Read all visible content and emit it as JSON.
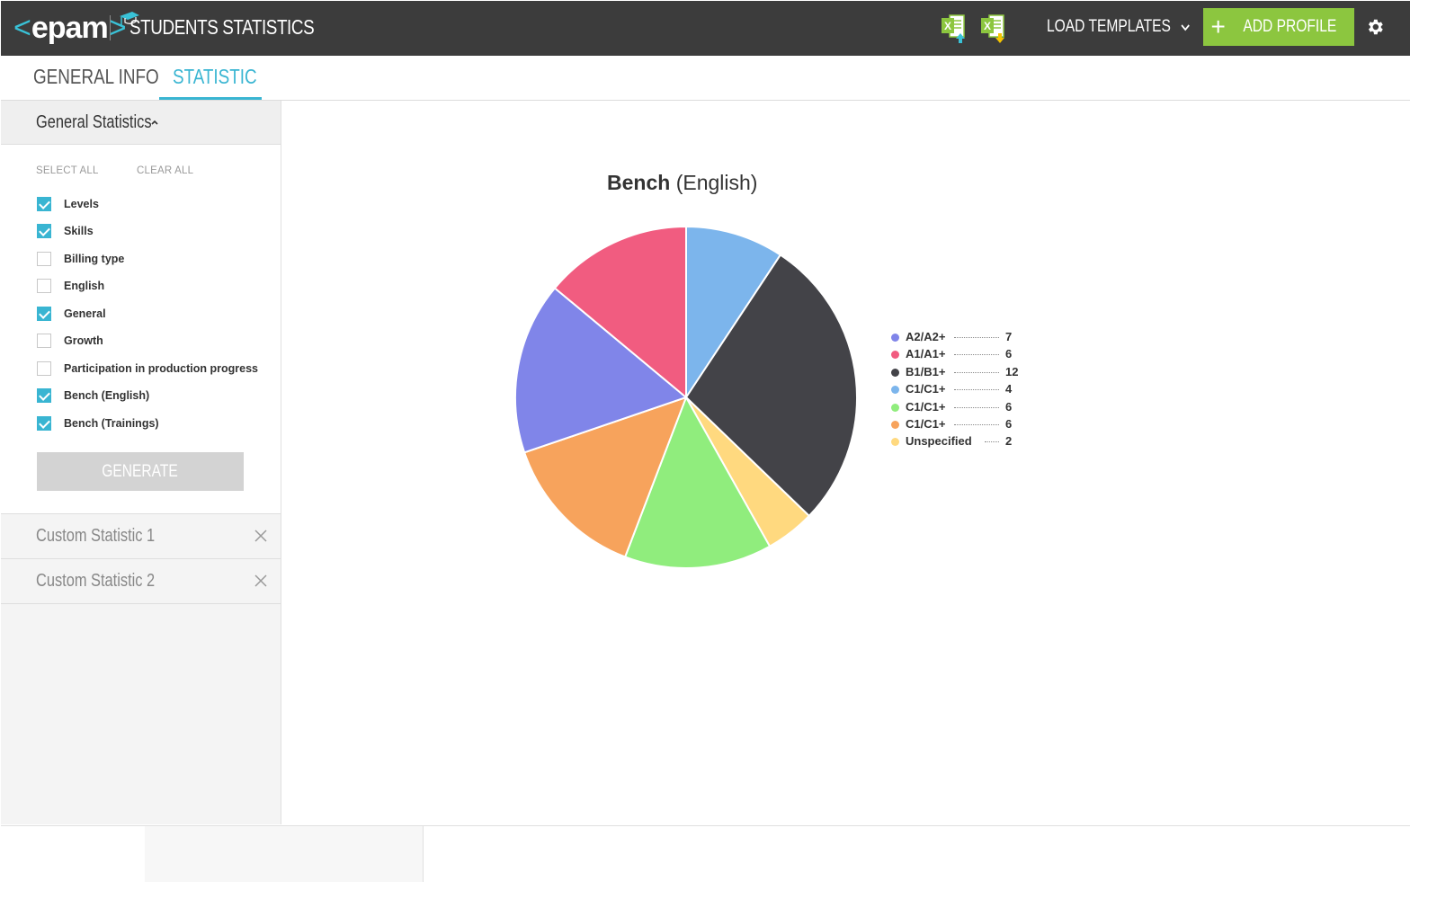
{
  "header": {
    "logo_left": "<",
    "logo_word": "epam",
    "logo_right": ">",
    "app_title": "STUDENTS STATISTICS",
    "load_templates_label": "LOAD TEMPLATES",
    "add_profile_label": "ADD PROFILE",
    "excel_import_icon": "excel-upload-icon",
    "excel_export_icon": "excel-download-icon",
    "accent_color": "#39c2d7",
    "add_button_color": "#8cc63f"
  },
  "tabs": [
    {
      "label": "GENERAL INFO",
      "active": false
    },
    {
      "label": "STATISTIC",
      "active": true
    }
  ],
  "sidebar": {
    "section_title": "General Statistics",
    "select_all": "SELECT ALL",
    "clear_all": "CLEAR ALL",
    "options": [
      {
        "label": "Levels",
        "checked": true
      },
      {
        "label": "Skills",
        "checked": true
      },
      {
        "label": "Billing type",
        "checked": false
      },
      {
        "label": "English",
        "checked": false
      },
      {
        "label": "General",
        "checked": true
      },
      {
        "label": "Growth",
        "checked": false
      },
      {
        "label": "Participation in production progress",
        "checked": false
      },
      {
        "label": "Bench (English)",
        "checked": true
      },
      {
        "label": "Bench (Trainings)",
        "checked": true
      }
    ],
    "generate_label": "GENERATE",
    "custom_statistics": [
      {
        "label": "Custom Statistic 1"
      },
      {
        "label": "Custom Statistic 2"
      }
    ]
  },
  "chart_data": {
    "type": "pie",
    "title_main": "Bench",
    "title_sub": "(English)",
    "legend_position": "right",
    "slices": [
      {
        "name": "C1/C1+",
        "value": 4,
        "color": "#7cb5ec"
      },
      {
        "name": "B1/B1+",
        "value": 12,
        "color": "#434348"
      },
      {
        "name": "Unspecified",
        "value": 2,
        "color": "#ffd97f"
      },
      {
        "name": "C1/C1+",
        "value": 6,
        "color": "#90ed7d"
      },
      {
        "name": "C1/C1+",
        "value": 6,
        "color": "#f7a35c"
      },
      {
        "name": "A2/A2+",
        "value": 7,
        "color": "#8085e9"
      },
      {
        "name": "A1/A1+",
        "value": 6,
        "color": "#f15c80"
      }
    ],
    "legend": [
      {
        "name": "A2/A2+",
        "value": "7",
        "color": "#8085e9"
      },
      {
        "name": "A1/A1+",
        "value": "6",
        "color": "#f15c80"
      },
      {
        "name": "B1/B1+",
        "value": "12",
        "color": "#434348"
      },
      {
        "name": "C1/C1+",
        "value": "4",
        "color": "#7cb5ec"
      },
      {
        "name": "C1/C1+",
        "value": "6",
        "color": "#90ed7d"
      },
      {
        "name": "C1/C1+",
        "value": "6",
        "color": "#f7a35c"
      },
      {
        "name": "Unspecified",
        "value": "2",
        "color": "#ffd97f"
      }
    ]
  }
}
